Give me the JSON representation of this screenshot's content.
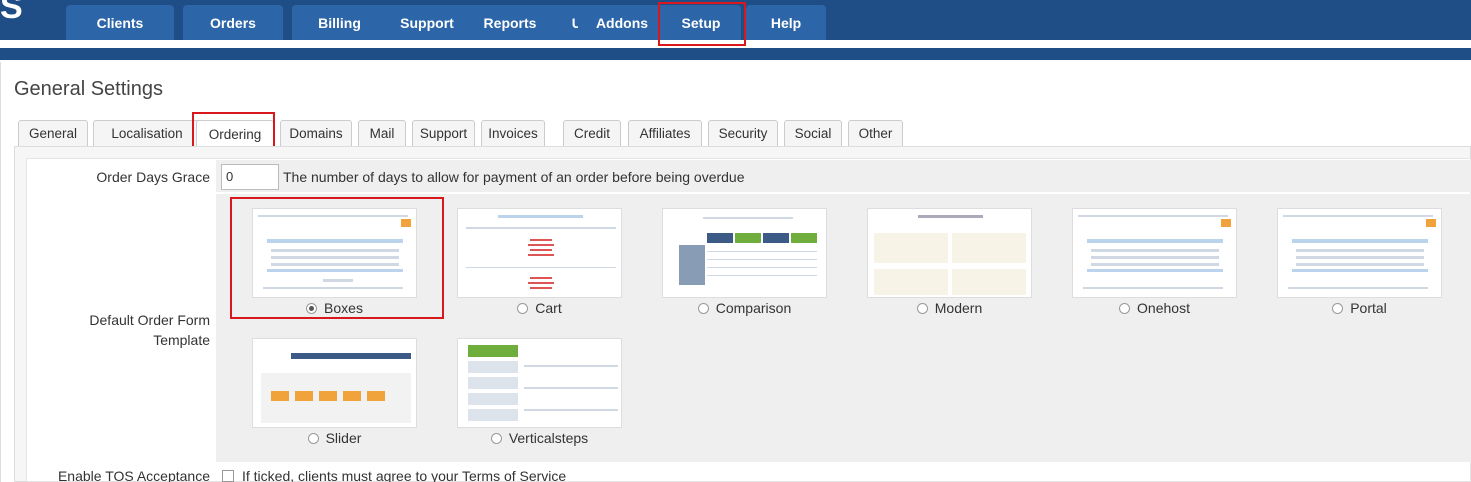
{
  "nav": {
    "logo_fragment": "S",
    "tabs": [
      {
        "label": "Clients"
      },
      {
        "label": "Orders"
      },
      {
        "label": "Billing"
      },
      {
        "label": "Support"
      },
      {
        "label": "Reports"
      },
      {
        "label": "Utilities"
      },
      {
        "label": "Addons"
      },
      {
        "label": "Setup"
      },
      {
        "label": "Help"
      }
    ],
    "active": "Setup"
  },
  "page": {
    "title": "General Settings"
  },
  "subtabs": {
    "items": [
      {
        "label": "General"
      },
      {
        "label": "Localisation"
      },
      {
        "label": "Ordering"
      },
      {
        "label": "Domains"
      },
      {
        "label": "Mail"
      },
      {
        "label": "Support"
      },
      {
        "label": "Invoices"
      },
      {
        "label": "Credit"
      },
      {
        "label": "Affiliates"
      },
      {
        "label": "Security"
      },
      {
        "label": "Social"
      },
      {
        "label": "Other"
      }
    ],
    "active": "Ordering"
  },
  "settings": {
    "order_days_grace": {
      "label": "Order Days Grace",
      "value": "0",
      "description": "The number of days to allow for payment of an order before being overdue"
    },
    "order_form_template": {
      "label_line1": "Default Order Form",
      "label_line2": "Template",
      "selected": "Boxes",
      "templates": [
        {
          "name": "Boxes"
        },
        {
          "name": "Cart"
        },
        {
          "name": "Comparison"
        },
        {
          "name": "Modern"
        },
        {
          "name": "Onehost"
        },
        {
          "name": "Portal"
        },
        {
          "name": "Slider"
        },
        {
          "name": "Verticalsteps"
        }
      ]
    },
    "tos": {
      "label": "Enable TOS Acceptance",
      "description": "If ticked, clients must agree to your Terms of Service",
      "checked": false
    }
  },
  "colors": {
    "nav_band": "#1f4d86",
    "nav_tab": "#2d66a8",
    "highlight": "#d9181e"
  }
}
